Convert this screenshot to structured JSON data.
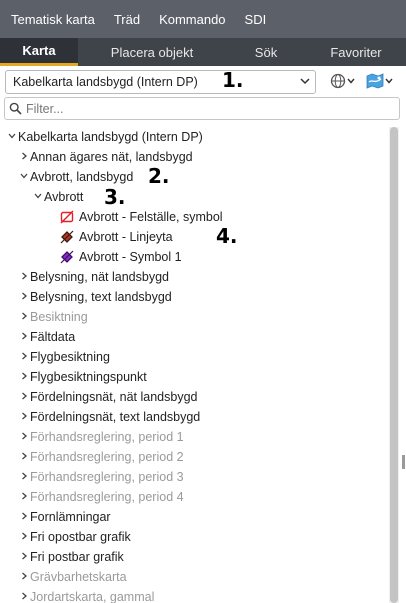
{
  "menu": [
    "Tematisk karta",
    "Träd",
    "Kommando",
    "SDI"
  ],
  "tabs": [
    "Karta",
    "Placera objekt",
    "Sök",
    "Favoriter"
  ],
  "active_tab": "Karta",
  "map_select": {
    "value": "Kabelkarta landsbygd (Intern DP)"
  },
  "annotations": {
    "n1": "1.",
    "n2": "2.",
    "n3": "3.",
    "n4": "4."
  },
  "filter": {
    "placeholder": "Filter..."
  },
  "tree": {
    "root": "Kabelkarta landsbygd (Intern DP)",
    "items": [
      "Annan ägares nät, landsbygd",
      "Avbrott, landsbygd",
      "Avbrott",
      "Avbrott - Felställe, symbol",
      "Avbrott - Linjeyta",
      "Avbrott - Symbol 1",
      "Belysning, nät landsbygd",
      "Belysning, text landsbygd",
      "Besiktning",
      "Fältdata",
      "Flygbesiktning",
      "Flygbesiktningspunkt",
      "Fördelningsnät, nät landsbygd",
      "Fördelningsnät, text landsbygd",
      "Förhandsreglering, period 1",
      "Förhandsreglering, period 2",
      "Förhandsreglering, period 3",
      "Förhandsreglering, period 4",
      "Fornlämningar",
      "Fri opostbar grafik",
      "Fri postbar grafik",
      "Grävbarhetskarta",
      "Jordartskarta, gammal"
    ]
  },
  "colors": {
    "accent": "#e5a823",
    "menu_bg": "#5c6068",
    "tab_bg": "#3f434a"
  }
}
